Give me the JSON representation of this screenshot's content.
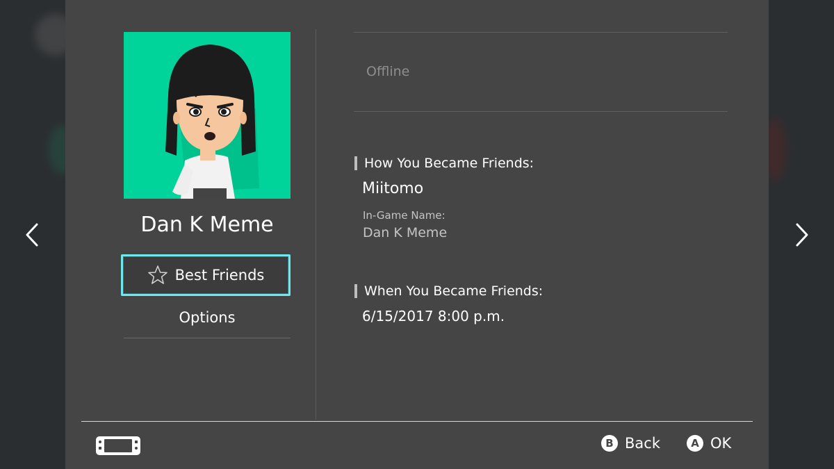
{
  "friend": {
    "name": "Dan K Meme",
    "status": "Offline",
    "best_friends_label": "Best Friends",
    "options_label": "Options"
  },
  "details": {
    "how_title": "How You Became Friends:",
    "how_value": "Miitomo",
    "in_game_label": "In-Game Name:",
    "in_game_value": "Dan K Meme",
    "when_title": "When You Became Friends:",
    "when_value": "6/15/2017 8:00 p.m."
  },
  "footer": {
    "back_glyph": "B",
    "back_label": "Back",
    "ok_glyph": "A",
    "ok_label": "OK"
  },
  "colors": {
    "panel": "#454545",
    "avatar_bg": "#00d49a",
    "focus_border": "#6fe7ec"
  },
  "icons": {
    "prev": "chevron-left-icon",
    "next": "chevron-right-icon",
    "star": "star-icon",
    "console": "handheld-console-icon"
  }
}
